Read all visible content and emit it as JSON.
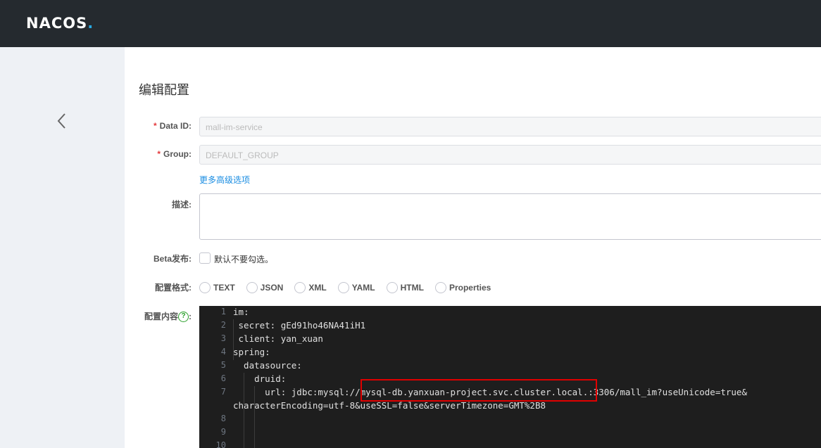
{
  "header": {
    "logo_main": "NACOS",
    "logo_dot": "."
  },
  "page": {
    "title": "编辑配置"
  },
  "form": {
    "data_id": {
      "required": "*",
      "label": "Data ID:",
      "value": "mall-im-service"
    },
    "group": {
      "required": "*",
      "label": "Group:",
      "value": "DEFAULT_GROUP"
    },
    "advanced_link": "更多高级选项",
    "description": {
      "label": "描述:",
      "value": ""
    },
    "beta": {
      "label": "Beta发布:",
      "checkbox_text": "默认不要勾选。"
    },
    "format": {
      "label": "配置格式:",
      "options": [
        "TEXT",
        "JSON",
        "XML",
        "YAML",
        "HTML",
        "Properties"
      ]
    },
    "content": {
      "label": "配置内容",
      "label_suffix": ":",
      "help": "?"
    }
  },
  "editor": {
    "line_numbers": [
      "1",
      "2",
      "3",
      "4",
      "5",
      "6",
      "7",
      "",
      "8",
      "9",
      "10"
    ],
    "lines": [
      "im:",
      " secret: gEd91ho46NA41iH1",
      " client: yan_xuan",
      "spring:",
      "  datasource:",
      "    druid:",
      "      url: jdbc:mysql://mysql-db.yanxuan-project.svc.cluster.local.:3306/mall_im?useUnicode=true&",
      "characterEncoding=utf-8&useSSL=false&serverTimezone=GMT%2B8",
      "",
      "",
      ""
    ]
  },
  "colors": {
    "topbar": "#252a2f",
    "sidebar": "#eef1f5",
    "accent": "#1a8de2",
    "highlight": "#e00000",
    "required": "#e4393c"
  }
}
